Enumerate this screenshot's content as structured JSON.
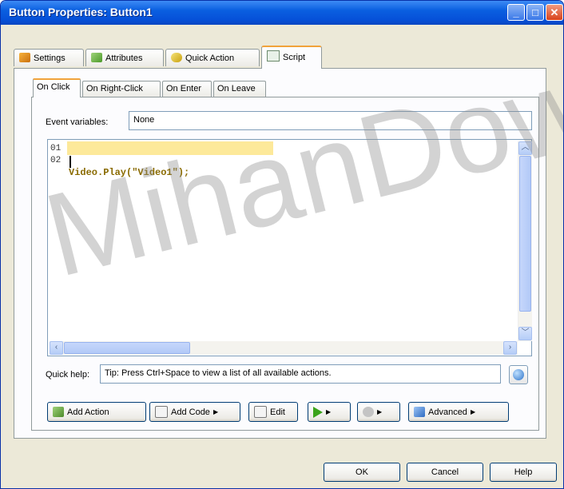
{
  "window": {
    "title": "Button Properties: Button1"
  },
  "main_tabs": [
    {
      "label": "Settings",
      "icon": "wrench-icon"
    },
    {
      "label": "Attributes",
      "icon": "gear-icon"
    },
    {
      "label": "Quick Action",
      "icon": "lightning-icon"
    },
    {
      "label": "Script",
      "icon": "script-icon",
      "active": true
    }
  ],
  "event_tabs": [
    {
      "label": "On Click",
      "active": true
    },
    {
      "label": "On Right-Click"
    },
    {
      "label": "On Enter"
    },
    {
      "label": "On Leave"
    }
  ],
  "event_vars": {
    "label": "Event variables:",
    "value": "None"
  },
  "editor": {
    "line_numbers": [
      "01",
      "02"
    ],
    "lines": [
      "Video.Play(\"Video1\");",
      ""
    ]
  },
  "quick_help": {
    "label": "Quick help:",
    "text": "Tip: Press Ctrl+Space to view a list of all available actions."
  },
  "toolbar": {
    "add_action": "Add Action",
    "add_code": "Add Code",
    "edit": "Edit",
    "advanced": "Advanced"
  },
  "footer": {
    "ok": "OK",
    "cancel": "Cancel",
    "help": "Help"
  },
  "watermark": "MihanDow",
  "colors": {
    "title_bar": "#0a5fe0",
    "tab_accent": "#f1a33b",
    "code_highlight": "#fde99a"
  }
}
